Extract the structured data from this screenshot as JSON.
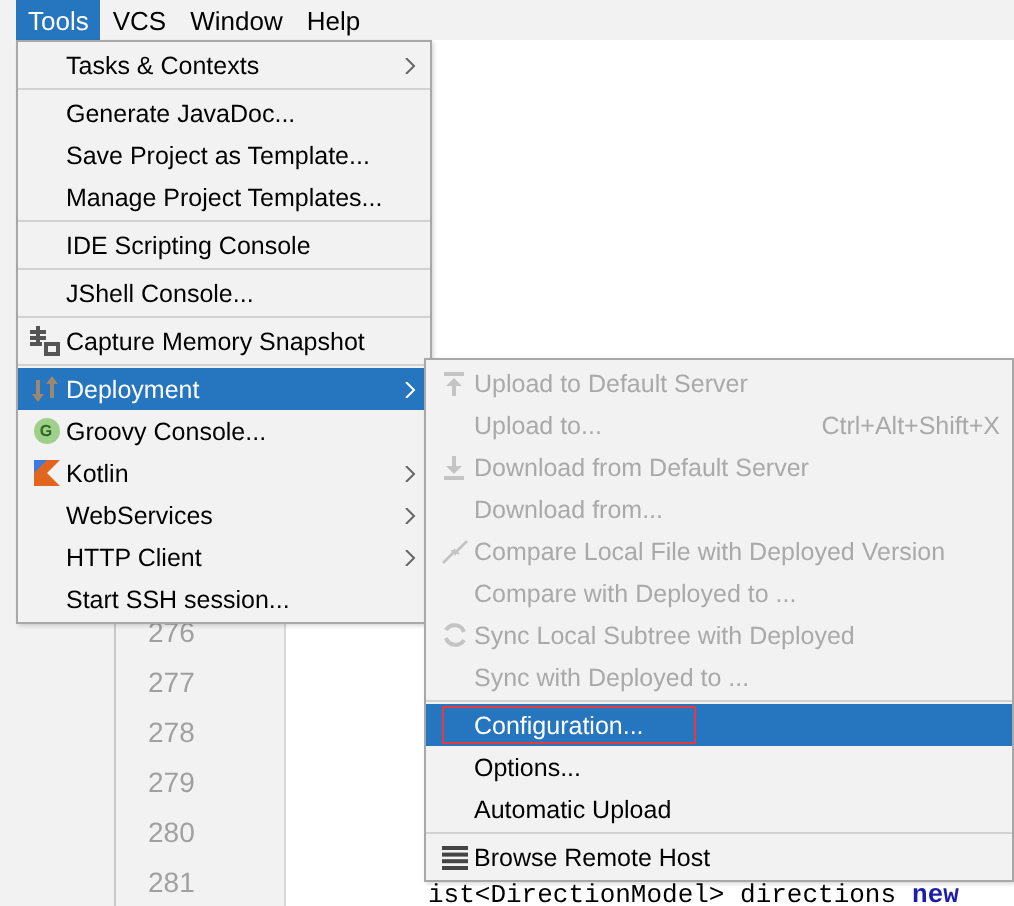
{
  "menu_bar": [
    {
      "label": "Tools",
      "selected": true
    },
    {
      "label": "VCS",
      "selected": false
    },
    {
      "label": "Window",
      "selected": false
    },
    {
      "label": "Help",
      "selected": false
    }
  ],
  "tools_menu": [
    {
      "label": "Tasks & Contexts",
      "submenu": true,
      "selected": false,
      "separator_after": true
    },
    {
      "label": "Generate JavaDoc...",
      "submenu": false,
      "selected": false,
      "separator_after": false
    },
    {
      "label": "Save Project as Template...",
      "submenu": false,
      "selected": false,
      "separator_after": false
    },
    {
      "label": "Manage Project Templates...",
      "submenu": false,
      "selected": false,
      "separator_after": true
    },
    {
      "label": "IDE Scripting Console",
      "submenu": false,
      "selected": false,
      "separator_after": true
    },
    {
      "label": "JShell Console...",
      "submenu": false,
      "selected": false,
      "separator_after": true
    },
    {
      "label": "Capture Memory Snapshot",
      "kind": "memory",
      "submenu": false,
      "selected": false,
      "separator_after": true
    },
    {
      "label": "Deployment",
      "kind": "deploy",
      "submenu": true,
      "selected": true,
      "separator_after": false
    },
    {
      "label": "Groovy Console...",
      "kind": "groovy",
      "icon_text": "G",
      "submenu": false,
      "selected": false,
      "separator_after": false
    },
    {
      "label": "Kotlin",
      "kind": "kotlin",
      "submenu": true,
      "selected": false,
      "separator_after": false
    },
    {
      "label": "WebServices",
      "submenu": true,
      "selected": false,
      "separator_after": false
    },
    {
      "label": "HTTP Client",
      "submenu": true,
      "selected": false,
      "separator_after": false
    },
    {
      "label": "Start SSH session...",
      "submenu": false,
      "selected": false,
      "separator_after": false
    }
  ],
  "deployment_menu": [
    {
      "label": "Upload to Default Server",
      "kind": "upload",
      "disabled": true,
      "selected": false,
      "separator_after": false
    },
    {
      "label": "Upload to...",
      "shortcut": "Ctrl+Alt+Shift+X",
      "disabled": true,
      "selected": false,
      "separator_after": false
    },
    {
      "label": "Download from Default Server",
      "kind": "download",
      "disabled": true,
      "selected": false,
      "separator_after": false
    },
    {
      "label": "Download from...",
      "disabled": true,
      "selected": false,
      "separator_after": false
    },
    {
      "label": "Compare Local File with Deployed Version",
      "kind": "compare",
      "disabled": true,
      "selected": false,
      "separator_after": false
    },
    {
      "label": "Compare with Deployed to ...",
      "disabled": true,
      "selected": false,
      "separator_after": false
    },
    {
      "label": "Sync Local Subtree with Deployed",
      "kind": "sync",
      "disabled": true,
      "selected": false,
      "separator_after": false
    },
    {
      "label": "Sync with Deployed to ...",
      "disabled": true,
      "selected": false,
      "separator_after": true
    },
    {
      "label": "Configuration...",
      "disabled": false,
      "selected": true,
      "outlined": true,
      "separator_after": false
    },
    {
      "label": "Options...",
      "disabled": false,
      "selected": false,
      "separator_after": false
    },
    {
      "label": "Automatic Upload",
      "disabled": false,
      "selected": false,
      "separator_after": true
    },
    {
      "label": "Browse Remote Host",
      "kind": "browse",
      "disabled": false,
      "selected": false,
      "separator_after": false
    }
  ],
  "editor": {
    "line_numbers": [
      "276",
      "277",
      "278",
      "279",
      "280",
      "281"
    ],
    "code_line": "ist<DirectionModel> directions",
    "code_keyword": "new"
  }
}
